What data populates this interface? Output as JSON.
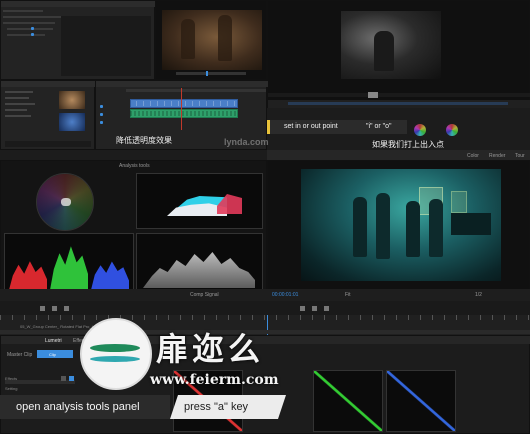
{
  "program_monitor": {
    "subtitle": "降低透明度效果",
    "watermark": "lynda.com"
  },
  "tooltip": {
    "label": "set in or out point",
    "keys": "\"i\" or \"o\""
  },
  "caption_right": "如果我们打上出入点",
  "right_tabs": [
    "Color",
    "Render",
    "Tour"
  ],
  "lumetri": {
    "title": "Analysis tools"
  },
  "timecode": "00:00:01:01",
  "monitor_controls": {
    "scope_select": "Comp Signal",
    "zoom_select": "Fit",
    "quality_select": "1/2"
  },
  "sequence_name": "05_W_Group Center_ Rotated Flat Pro_Landscape",
  "source_panel": {
    "tabs": [
      "Lumetri",
      "Effect"
    ],
    "clip_label": "Master Clip",
    "row_label": "Clip",
    "sub_items": [
      "Effects",
      "Setting"
    ]
  },
  "site_logo": {
    "name": "扉迩么",
    "url": "www.feierm.com"
  },
  "bottom_caption": {
    "left": "open analysis tools panel",
    "right": "press \"a\" key"
  },
  "colors": {
    "accent_blue": "#3b8dde",
    "timeline_green": "#2ea06a",
    "timeline_blue": "#4a7fc8",
    "playhead_red": "#c0392b",
    "tooltip_yellow": "#e8c23a"
  }
}
